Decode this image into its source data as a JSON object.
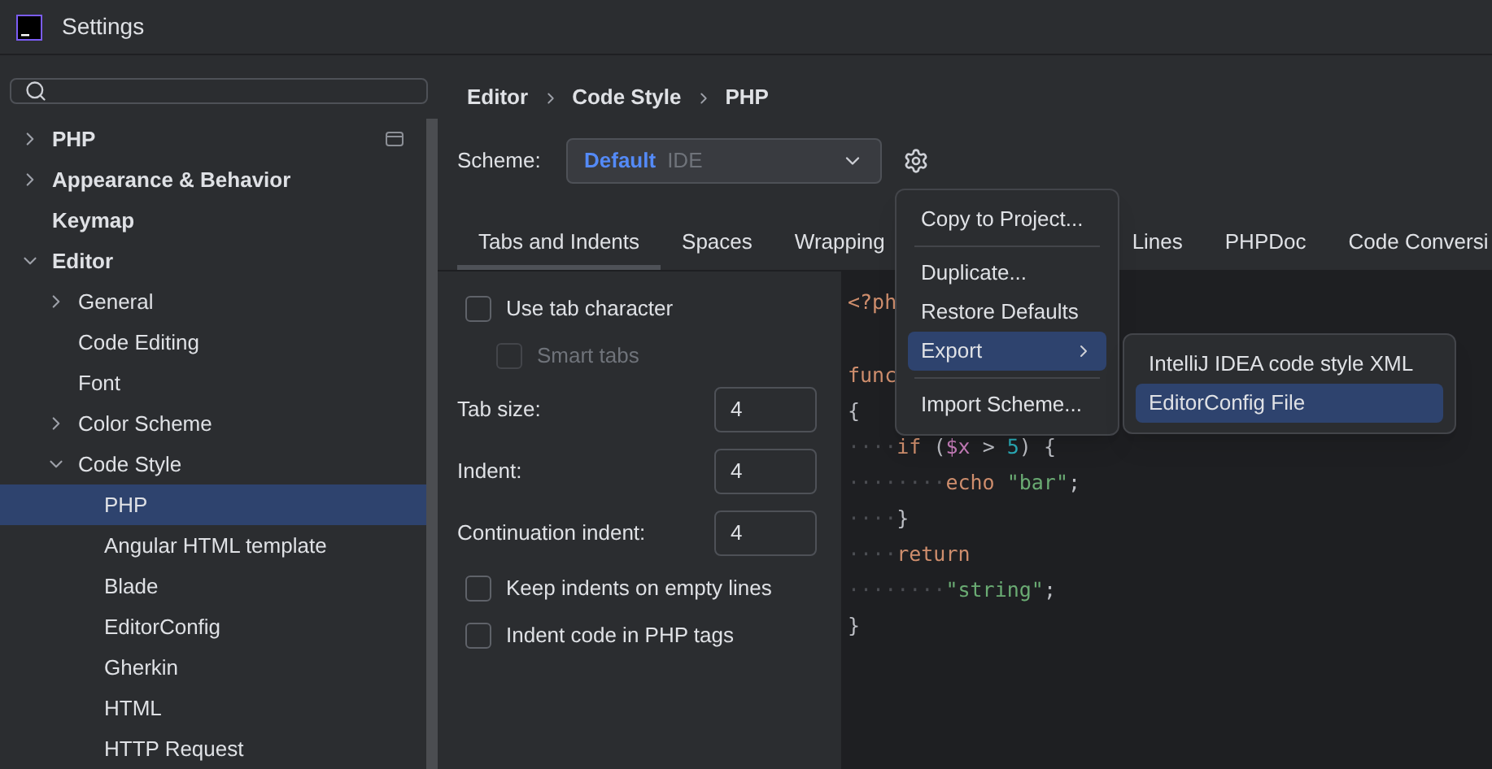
{
  "window": {
    "title": "Settings"
  },
  "sidebar": {
    "items": [
      {
        "label": "PHP",
        "expanded": false,
        "scope_icon": true
      },
      {
        "label": "Appearance & Behavior",
        "expanded": false
      },
      {
        "label": "Keymap"
      },
      {
        "label": "Editor",
        "expanded": true,
        "children": [
          {
            "label": "General",
            "expanded": false
          },
          {
            "label": "Code Editing"
          },
          {
            "label": "Font"
          },
          {
            "label": "Color Scheme",
            "expanded": false
          },
          {
            "label": "Code Style",
            "expanded": true,
            "children": [
              {
                "label": "PHP",
                "selected": true
              },
              {
                "label": "Angular HTML template",
                "selected": false
              },
              {
                "label": "Blade",
                "selected": false
              },
              {
                "label": "EditorConfig",
                "selected": false
              },
              {
                "label": "Gherkin",
                "selected": false
              },
              {
                "label": "HTML",
                "selected": false
              },
              {
                "label": "HTTP Request",
                "selected": false
              }
            ]
          }
        ]
      }
    ]
  },
  "breadcrumb": [
    "Editor",
    "Code Style",
    "PHP"
  ],
  "scheme": {
    "label": "Scheme:",
    "name": "Default",
    "scope": "IDE"
  },
  "tabs": [
    {
      "label": "Tabs and Indents",
      "selected": true
    },
    {
      "label": "Spaces",
      "selected": false
    },
    {
      "label": "Wrapping",
      "selected": false
    },
    {
      "label": "Lines",
      "selected": false
    },
    {
      "label": "PHPDoc",
      "selected": false
    },
    {
      "label": "Code Conversi",
      "selected": false
    }
  ],
  "options": [
    {
      "kind": "checkbox",
      "label": "Use tab character",
      "checked": false,
      "disabled": false,
      "indented": false
    },
    {
      "kind": "checkbox",
      "label": "Smart tabs",
      "checked": false,
      "disabled": true,
      "indented": true
    },
    {
      "kind": "field",
      "label": "Tab size:",
      "value": "4"
    },
    {
      "kind": "field",
      "label": "Indent:",
      "value": "4"
    },
    {
      "kind": "field",
      "label": "Continuation indent:",
      "value": "4"
    },
    {
      "kind": "checkbox",
      "label": "Keep indents on empty lines",
      "checked": false,
      "disabled": false,
      "indented": false
    },
    {
      "kind": "checkbox",
      "label": "Indent code in PHP tags",
      "checked": false,
      "disabled": false,
      "indented": false
    }
  ],
  "code_lines": [
    {
      "tokens": [
        {
          "kind": "kw",
          "text": "<?ph"
        }
      ]
    },
    {
      "blank_before": true,
      "tokens": [
        {
          "kind": "kw",
          "text": "func"
        }
      ]
    },
    {
      "tokens": [
        {
          "kind": "plain",
          "text": "{"
        }
      ]
    },
    {
      "tokens": [
        {
          "kind": "ws",
          "text": "····"
        },
        {
          "kind": "kw",
          "text": "if"
        },
        {
          "kind": "plain",
          "text": " ("
        },
        {
          "kind": "var",
          "text": "$x"
        },
        {
          "kind": "plain",
          "text": " > "
        },
        {
          "kind": "num",
          "text": "5"
        },
        {
          "kind": "plain",
          "text": ") {"
        }
      ]
    },
    {
      "tokens": [
        {
          "kind": "ws",
          "text": "········"
        },
        {
          "kind": "kw",
          "text": "echo "
        },
        {
          "kind": "str",
          "text": "\"bar\""
        },
        {
          "kind": "plain",
          "text": ";"
        }
      ]
    },
    {
      "tokens": [
        {
          "kind": "ws",
          "text": "····"
        },
        {
          "kind": "plain",
          "text": "}"
        }
      ]
    },
    {
      "tokens": [
        {
          "kind": "ws",
          "text": "····"
        },
        {
          "kind": "kw",
          "text": "return"
        }
      ]
    },
    {
      "tokens": [
        {
          "kind": "ws",
          "text": "········"
        },
        {
          "kind": "str",
          "text": "\"string\""
        },
        {
          "kind": "plain",
          "text": ";"
        }
      ]
    },
    {
      "tokens": [
        {
          "kind": "plain",
          "text": "}"
        }
      ]
    }
  ],
  "menu": {
    "items": [
      {
        "kind": "item",
        "label": "Copy to Project...",
        "selected": false
      },
      {
        "kind": "separator"
      },
      {
        "kind": "item",
        "label": "Duplicate...",
        "selected": false
      },
      {
        "kind": "item",
        "label": "Restore Defaults",
        "selected": false
      },
      {
        "kind": "submenu",
        "label": "Export",
        "selected": true
      },
      {
        "kind": "separator"
      },
      {
        "kind": "item",
        "label": "Import Scheme...",
        "selected": false
      }
    ],
    "submenu": [
      {
        "label": "IntelliJ IDEA code style XML",
        "selected": false
      },
      {
        "label": "EditorConfig File",
        "selected": true
      }
    ]
  }
}
